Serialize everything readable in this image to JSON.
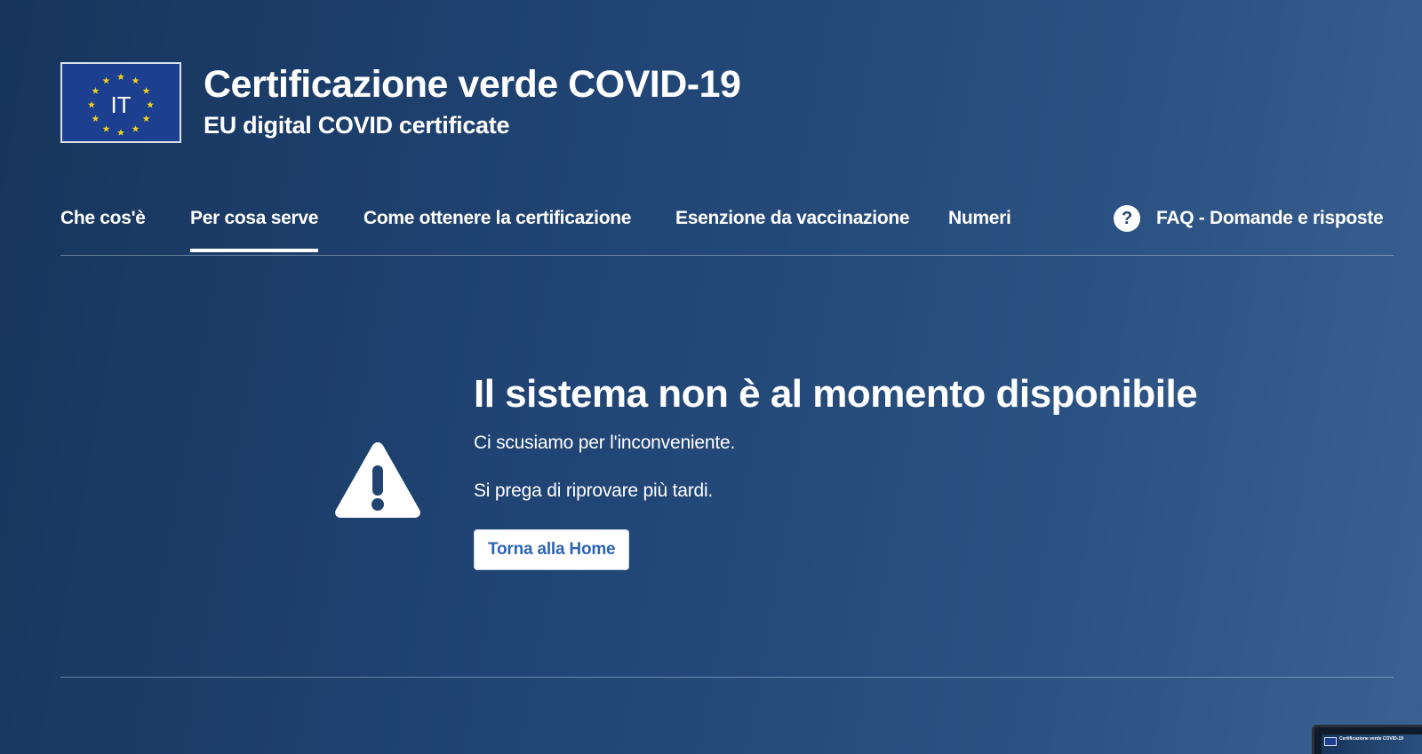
{
  "header": {
    "flag_label": "IT",
    "title": "Certificazione verde COVID-19",
    "subtitle": "EU digital COVID certificate"
  },
  "nav": {
    "items": [
      {
        "label": "Che cos'è",
        "active": false
      },
      {
        "label": "Per cosa serve",
        "active": true
      },
      {
        "label": "Come ottenere la certificazione",
        "active": false
      },
      {
        "label": "Esenzione da vaccinazione",
        "active": false
      },
      {
        "label": "Numeri",
        "active": false
      }
    ],
    "faq": {
      "icon": "question-circle-icon",
      "icon_glyph": "?",
      "label": "FAQ - Domande e risposte"
    }
  },
  "error": {
    "icon": "warning-triangle-icon",
    "title": "Il sistema non è al momento disponibile",
    "message1": "Ci scusiamo per l'inconveniente.",
    "message2": "Si prega di riprovare più tardi.",
    "button_label": "Torna alla Home"
  },
  "thumbnail": {
    "caption": "Certificazione verde COVID-19"
  },
  "colors": {
    "background_dark": "#17355c",
    "background_light": "#3a6192",
    "flag_blue": "#1d3f8f",
    "star_yellow": "#f4d21f",
    "button_text": "#2d64b3"
  }
}
